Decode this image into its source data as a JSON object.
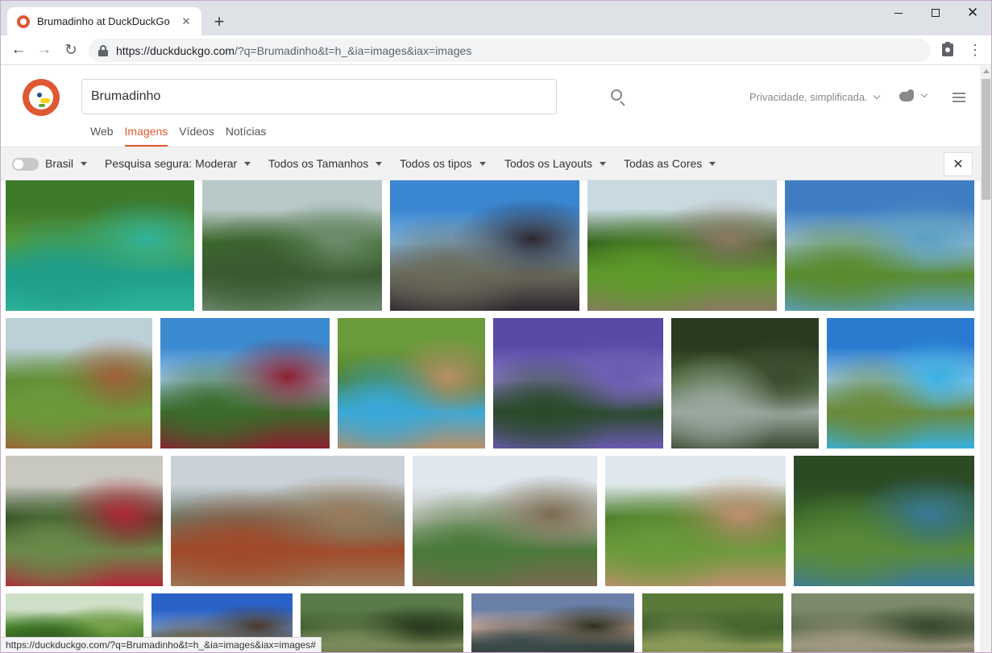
{
  "browser": {
    "tab_title": "Brumadinho at DuckDuckGo",
    "url_host": "https://duckduckgo.com",
    "url_path": "/?q=Brumadinho&t=h_&ia=images&iax=images",
    "status_url": "https://duckduckgo.com/?q=Brumadinho&t=h_&ia=images&iax=images#"
  },
  "search": {
    "query": "Brumadinho"
  },
  "nav_tabs": [
    "Web",
    "Imagens",
    "Vídeos",
    "Notícias"
  ],
  "active_tab": "Imagens",
  "header_right": {
    "privacy_label": "Privacidade, simplificada."
  },
  "filters": {
    "region": "Brasil",
    "safe_search": "Pesquisa segura: Moderar",
    "size": "Todos os Tamanhos",
    "type": "Todos os tipos",
    "layout": "Todos os Layouts",
    "color": "Todas as Cores"
  },
  "colors": {
    "accent": "#de5833",
    "filter_bar": "#f2f2f2"
  },
  "images": [
    {
      "name": "green-pond-lawn",
      "colors": [
        "#3e7a2c",
        "#5a9a32",
        "#1f9e8a",
        "#2fb39b"
      ]
    },
    {
      "name": "palm-lake-reflection",
      "colors": [
        "#b9c9c9",
        "#3c6b2a",
        "#3b5a32",
        "#6f8c70"
      ]
    },
    {
      "name": "mirror-balls-pool",
      "colors": [
        "#3a86d0",
        "#7fb6e4",
        "#6a6a5a",
        "#2e2830"
      ]
    },
    {
      "name": "palm-garden-bench",
      "colors": [
        "#c8d9df",
        "#2e5a1c",
        "#5e9a2a",
        "#8a7a62"
      ]
    },
    {
      "name": "mountain-lake-garden",
      "colors": [
        "#3f7ec2",
        "#9cbfd8",
        "#5a8a2e",
        "#5aa0c0"
      ]
    },
    {
      "name": "farm-hillside",
      "colors": [
        "#bcd0d8",
        "#5d8a36",
        "#6c9a3a",
        "#a0603a"
      ]
    },
    {
      "name": "lake-red-plants",
      "colors": [
        "#3c8ad0",
        "#a0c8e6",
        "#3b6b2a",
        "#8a2030"
      ]
    },
    {
      "name": "resort-pool-render",
      "colors": [
        "#6a9a3a",
        "#4c8030",
        "#3aa8d8",
        "#b89068"
      ]
    },
    {
      "name": "purple-sky-lake",
      "colors": [
        "#5a4aa6",
        "#8a7ac8",
        "#2a4a2a",
        "#6a5ab0"
      ]
    },
    {
      "name": "waterfall-rocks",
      "colors": [
        "#2a3a20",
        "#4e6a3a",
        "#9aa8a0",
        "#3a4a30"
      ]
    },
    {
      "name": "modern-pavilion-pool",
      "colors": [
        "#2a7ad0",
        "#9ac8ea",
        "#6a8a3a",
        "#3ab0e0"
      ]
    },
    {
      "name": "garden-path-palms",
      "colors": [
        "#c8c8c0",
        "#2c4a20",
        "#6a8a4a",
        "#b02a3a"
      ]
    },
    {
      "name": "town-hills",
      "colors": [
        "#c9d2d8",
        "#6a7a6a",
        "#a04a2a",
        "#9a7a5a"
      ]
    },
    {
      "name": "colonial-town-bridge",
      "colors": [
        "#dfe8ee",
        "#c0c0b8",
        "#4a7a3a",
        "#7a6a50"
      ]
    },
    {
      "name": "telescope-sculpture",
      "colors": [
        "#dfe8ec",
        "#4a7a2a",
        "#6a9a3a",
        "#c09070"
      ]
    },
    {
      "name": "colorful-art-pavilion",
      "colors": [
        "#2c4a24",
        "#3a6a2a",
        "#5a8a3a",
        "#3a7a9a"
      ]
    },
    {
      "name": "tree-canopy",
      "colors": [
        "#cfe0c8",
        "#4a8a2a",
        "#2f5a20",
        "#7aa04a"
      ]
    },
    {
      "name": "blue-sky-tree",
      "colors": [
        "#2a62c8",
        "#6a96d8",
        "#6a5a3a",
        "#4a3a2a"
      ]
    },
    {
      "name": "dense-forest",
      "colors": [
        "#5a7a4a",
        "#3a5a2a",
        "#7a8a5a",
        "#2a3a20"
      ]
    },
    {
      "name": "sunset-valley",
      "colors": [
        "#6a80a8",
        "#d8b0a0",
        "#3a4a4a",
        "#2a3020"
      ]
    },
    {
      "name": "green-foliage",
      "colors": [
        "#5a7a3a",
        "#3a5a2a",
        "#8a9a5a",
        "#4a6a30"
      ]
    },
    {
      "name": "rocky-stream",
      "colors": [
        "#7a8a6a",
        "#5a6a4a",
        "#a09880",
        "#3a4a30"
      ]
    }
  ]
}
